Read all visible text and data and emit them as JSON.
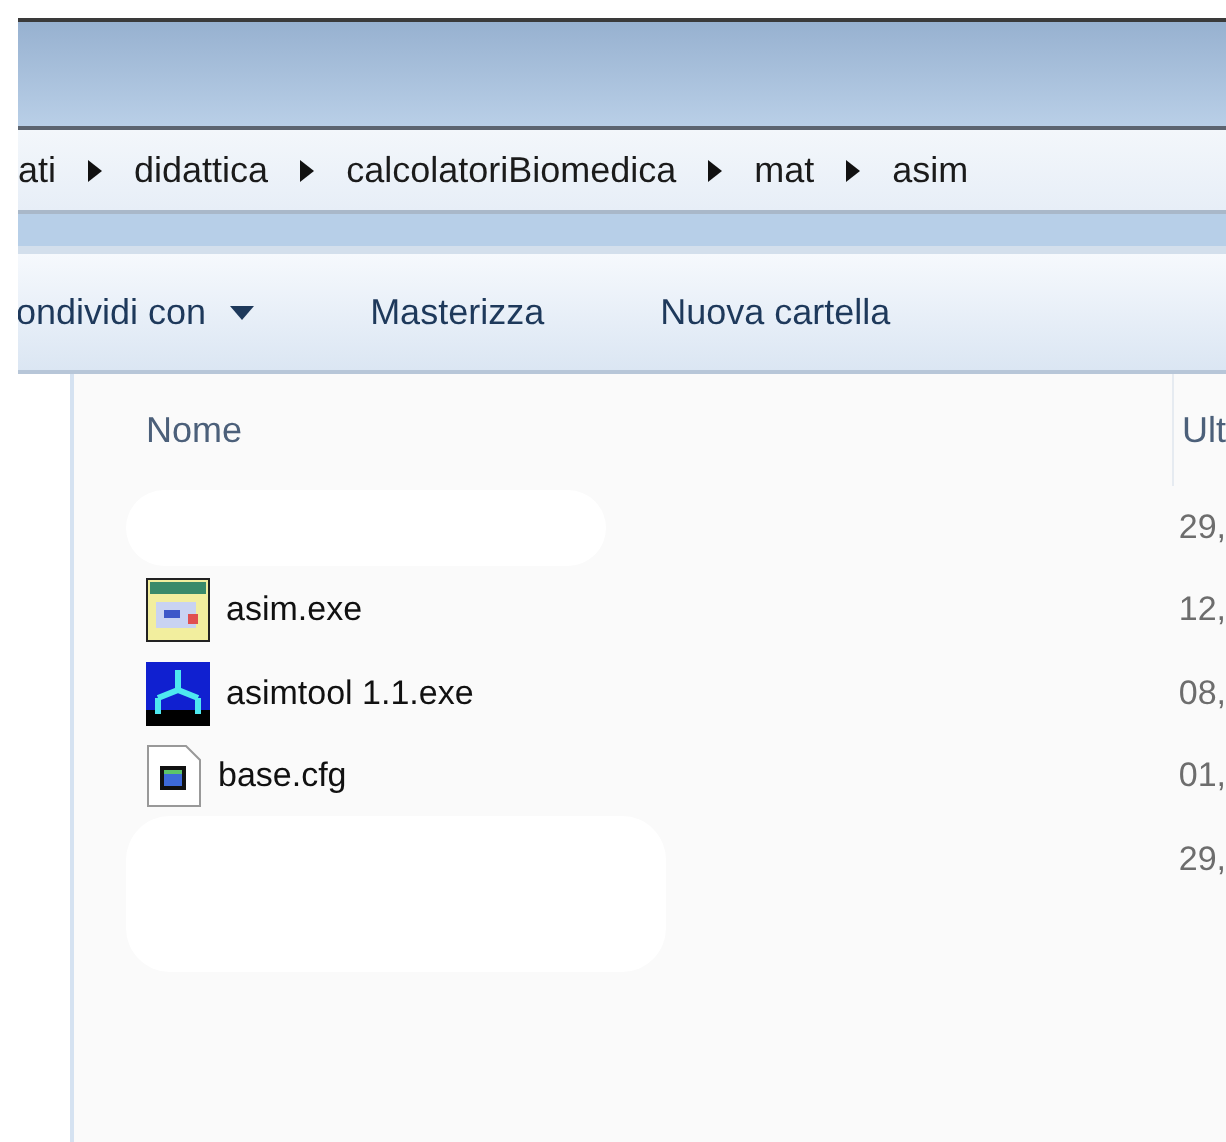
{
  "breadcrumb": [
    "ati",
    "didattica",
    "calcolatoriBiomedica",
    "mat",
    "asim"
  ],
  "toolbar": [
    {
      "label": "ondividi con",
      "dropdown": true
    },
    {
      "label": "Masterizza",
      "dropdown": false
    },
    {
      "label": "Nuova cartella",
      "dropdown": false
    }
  ],
  "columns": [
    "Nome",
    "Ult"
  ],
  "rows": [
    {
      "kind": "redacted",
      "date": "29,"
    },
    {
      "kind": "window",
      "name": "asim.exe",
      "date": "12,"
    },
    {
      "kind": "tool",
      "name": "asimtool 1.1.exe",
      "date": "08,"
    },
    {
      "kind": "config",
      "name": "base.cfg",
      "date": "01,"
    },
    {
      "kind": "redacted",
      "date": "29,"
    }
  ]
}
